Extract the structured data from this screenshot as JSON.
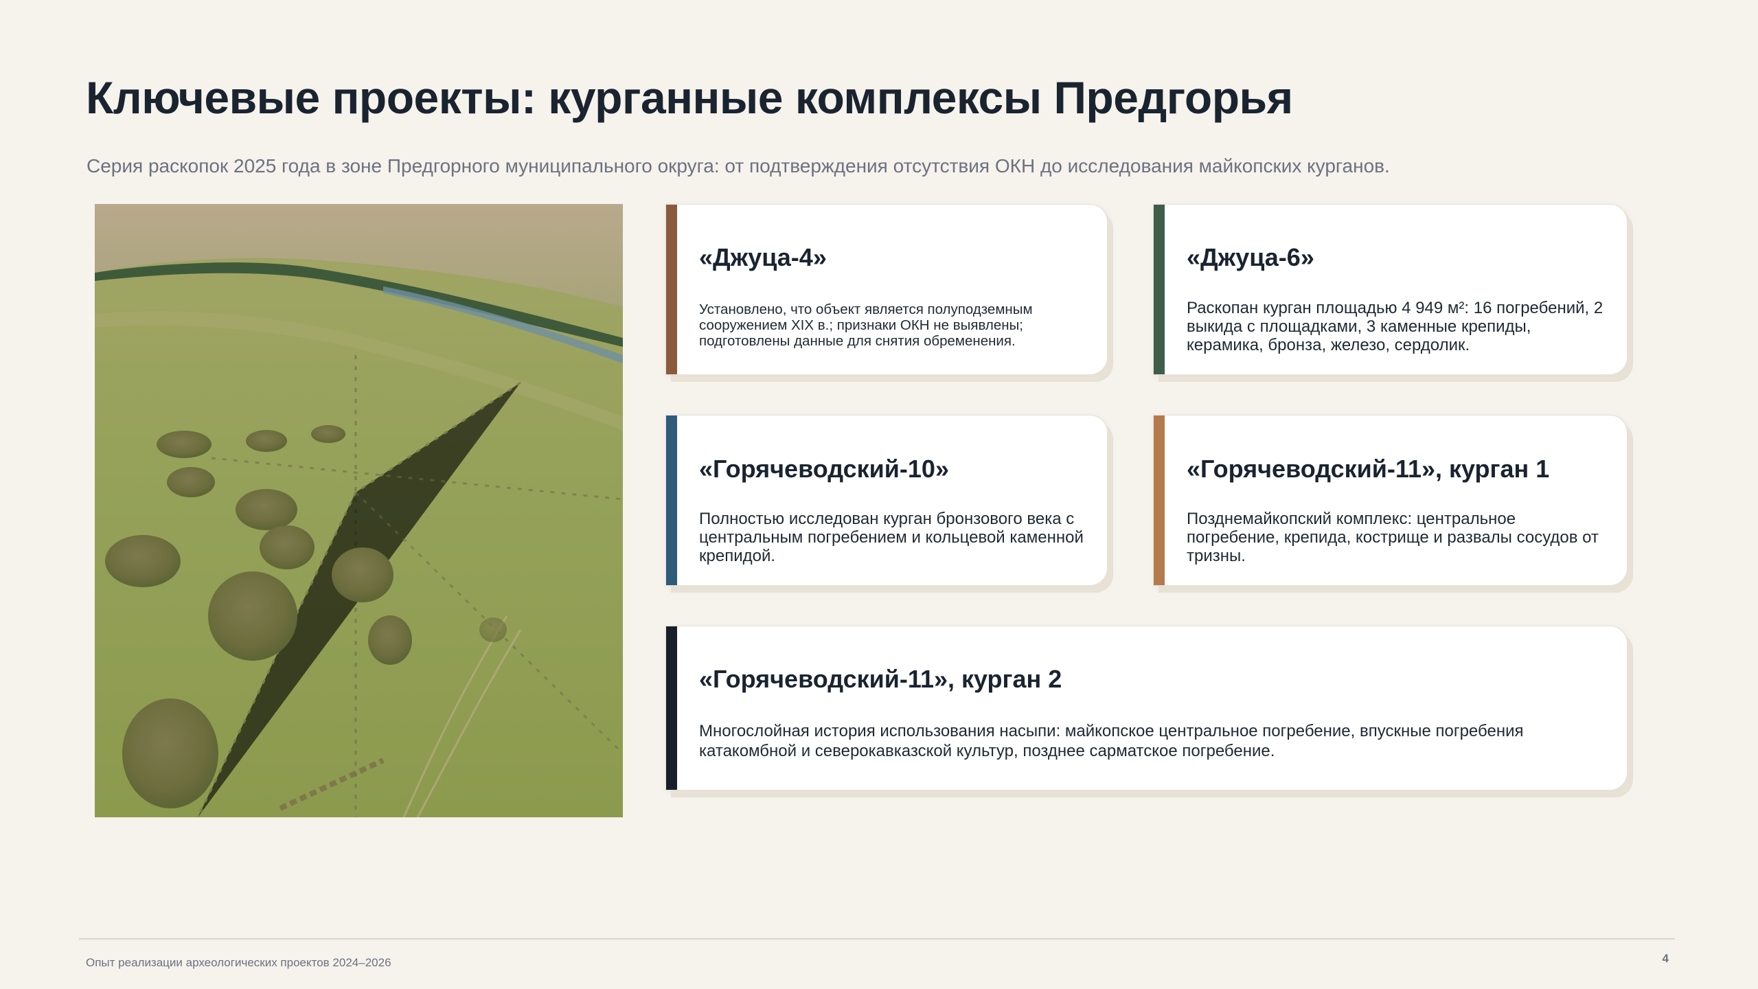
{
  "slide": {
    "title": "Ключевые проекты: курганные комплексы Предгорья",
    "subtitle": "Серия раскопок 2025 года в зоне Предгорного муниципального округа: от подтверждения отсутствия ОКН до исследования майкопских курганов."
  },
  "cards": [
    {
      "title": "«Джуца-4»",
      "text": "Установлено, что объект является полуподземным сооружением XIX в.; признаки ОКН не выявлены; подготовлены данные для снятия обременения.",
      "accent": "#8b5a3c"
    },
    {
      "title": "«Джуца-6»",
      "text": "Раскопан курган площадью 4 949 м²: 16 погребений, 2 выкида с площадками, 3 каменные крепиды, керамика, бронза, железо, сердолик.",
      "accent": "#3e5e4a"
    },
    {
      "title": "«Горячеводский-10»",
      "text": "Полностью исследован курган бронзового века с центральным погребением и кольцевой каменной крепидой.",
      "accent": "#2f5a78"
    },
    {
      "title": "«Горячеводский-11», курган 1",
      "text": "Позднемайкопский комплекс: центральное погребение, крепида, кострище и развалы сосудов от тризны.",
      "accent": "#b57a4c"
    },
    {
      "title": "«Горячеводский-11», курган 2",
      "text": "Многослойная история использования насыпи: майкопское центральное погребение, впускные погребения катакомбной и северокавказской культур, позднее сарматское погребение.",
      "accent": "#17202a"
    }
  ],
  "photo": {
    "icon": "aerial-photo-kurgans"
  },
  "footer": {
    "text": "Опыт реализации археологических проектов 2024–2026",
    "page": "4"
  }
}
